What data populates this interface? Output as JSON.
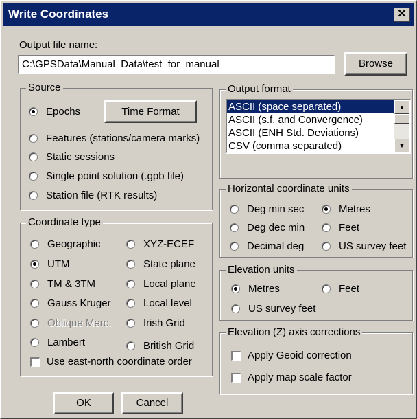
{
  "window": {
    "title": "Write Coordinates",
    "close_glyph": "✕"
  },
  "output_file": {
    "label": "Output file name:",
    "value": "C:\\GPSData\\Manual_Data\\test_for_manual",
    "browse_label": "Browse"
  },
  "source": {
    "title": "Source",
    "options": [
      {
        "label": "Epochs",
        "checked": true
      },
      {
        "label": "Features (stations/camera marks)",
        "checked": false
      },
      {
        "label": "Static sessions",
        "checked": false
      },
      {
        "label": "Single point solution (.gpb file)",
        "checked": false
      },
      {
        "label": "Station file (RTK results)",
        "checked": false
      }
    ],
    "time_format_label": "Time Format"
  },
  "output_format": {
    "title": "Output format",
    "items": [
      "ASCII (space separated)",
      "ASCII (s.f. and Convergence)",
      "ASCII (ENH Std. Deviations)",
      "CSV (comma separated)"
    ],
    "selected": "ASCII (space separated)"
  },
  "horizontal_units": {
    "title": "Horizontal coordinate units",
    "options": [
      {
        "label": "Deg min sec",
        "checked": false
      },
      {
        "label": "Metres",
        "checked": true
      },
      {
        "label": "Deg dec min",
        "checked": false
      },
      {
        "label": "Feet",
        "checked": false
      },
      {
        "label": "Decimal deg",
        "checked": false
      },
      {
        "label": "US survey feet",
        "checked": false
      }
    ]
  },
  "elevation_units": {
    "title": "Elevation units",
    "options": [
      {
        "label": "Metres",
        "checked": true
      },
      {
        "label": "Feet",
        "checked": false
      },
      {
        "label": "US survey feet",
        "checked": false
      }
    ]
  },
  "coordinate_type": {
    "title": "Coordinate type",
    "options": [
      {
        "label": "Geographic",
        "checked": false,
        "enabled": true
      },
      {
        "label": "XYZ-ECEF",
        "checked": false,
        "enabled": true
      },
      {
        "label": "UTM",
        "checked": true,
        "enabled": true
      },
      {
        "label": "State plane",
        "checked": false,
        "enabled": true
      },
      {
        "label": "TM & 3TM",
        "checked": false,
        "enabled": true
      },
      {
        "label": "Local plane",
        "checked": false,
        "enabled": true
      },
      {
        "label": "Gauss Kruger",
        "checked": false,
        "enabled": true
      },
      {
        "label": "Local level",
        "checked": false,
        "enabled": true
      },
      {
        "label": "Oblique Merc.",
        "checked": false,
        "enabled": false
      },
      {
        "label": "Irish Grid",
        "checked": false,
        "enabled": true
      },
      {
        "label": "Lambert",
        "checked": false,
        "enabled": true
      },
      {
        "label": "British Grid",
        "checked": false,
        "enabled": true
      }
    ],
    "east_north_label": "Use east-north coordinate order",
    "east_north_checked": false
  },
  "elevation_corrections": {
    "title": "Elevation (Z) axis corrections",
    "geoid_label": "Apply Geoid correction",
    "geoid_checked": false,
    "scale_label": "Apply map scale factor",
    "scale_checked": false
  },
  "buttons": {
    "ok": "OK",
    "cancel": "Cancel"
  }
}
